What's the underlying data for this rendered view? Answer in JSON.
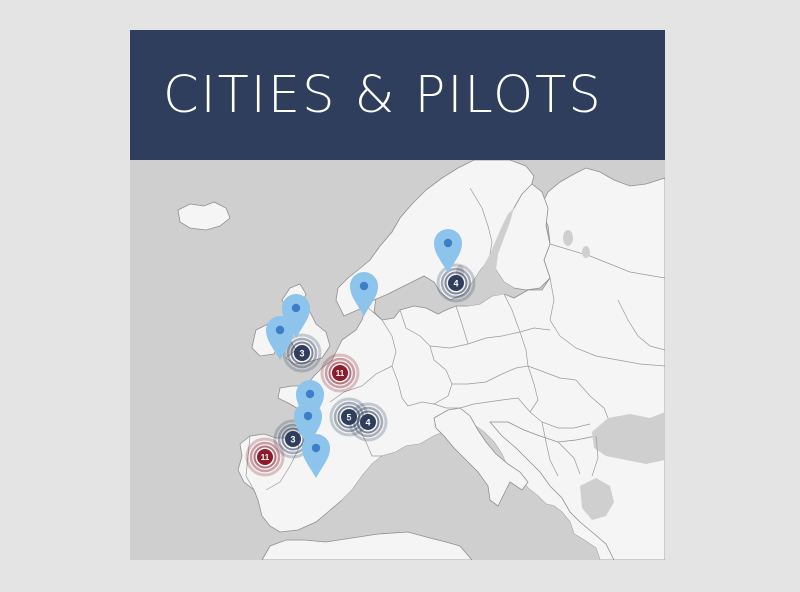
{
  "header": {
    "title": "CITIES & PILOTS"
  },
  "colors": {
    "header_bg": "#2e3e5c",
    "land": "#f5f5f5",
    "sea": "#cfcfcf",
    "pin": "#8cc4ec",
    "pin_dot": "#3d7fc6",
    "cluster_navy": "#2e3e5c",
    "cluster_red": "#8b1c2c"
  },
  "map": {
    "pins": [
      {
        "name": "pin-finland"
      },
      {
        "name": "pin-norway"
      },
      {
        "name": "pin-scotland"
      },
      {
        "name": "pin-ireland"
      },
      {
        "name": "pin-belgium"
      },
      {
        "name": "pin-france-central"
      },
      {
        "name": "pin-france-south"
      }
    ],
    "clusters": [
      {
        "name": "cluster-finland",
        "count": "4",
        "color": "navy"
      },
      {
        "name": "cluster-uk",
        "count": "3",
        "color": "navy"
      },
      {
        "name": "cluster-netherlands",
        "count": "11",
        "color": "red"
      },
      {
        "name": "cluster-switzerland",
        "count": "5",
        "color": "navy"
      },
      {
        "name": "cluster-italy-north",
        "count": "4",
        "color": "navy"
      },
      {
        "name": "cluster-southwest-france",
        "count": "3",
        "color": "navy"
      },
      {
        "name": "cluster-spain-west",
        "count": "11",
        "color": "red"
      }
    ]
  }
}
